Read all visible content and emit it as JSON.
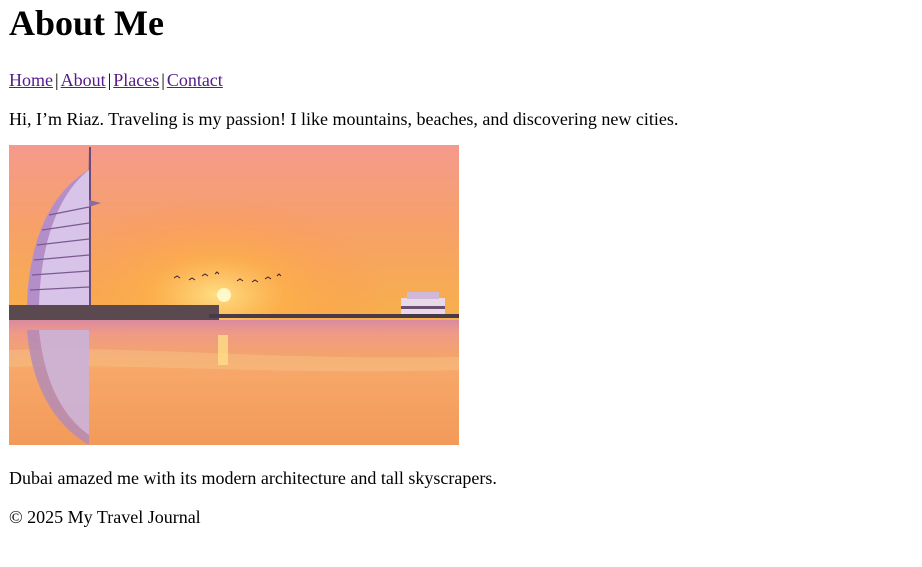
{
  "page": {
    "title": "About Me"
  },
  "nav": {
    "items": [
      {
        "label": "Home"
      },
      {
        "label": "About"
      },
      {
        "label": "Places"
      },
      {
        "label": "Contact"
      }
    ],
    "separator": "|"
  },
  "content": {
    "intro": "Hi, I’m Riaz. Traveling is my passion! I like mountains, beaches, and discovering new cities.",
    "photo_alt": "Sunset over Dubai beach with Burj Al Arab",
    "caption": "Dubai amazed me with its modern architecture and tall skyscrapers."
  },
  "footer": {
    "text": "© 2025 My Travel Journal"
  },
  "colors": {
    "link_visited": "#551a8b",
    "sky_top": "#f79a8a",
    "sun": "#fff6b0",
    "sea": "#f0a46a"
  }
}
